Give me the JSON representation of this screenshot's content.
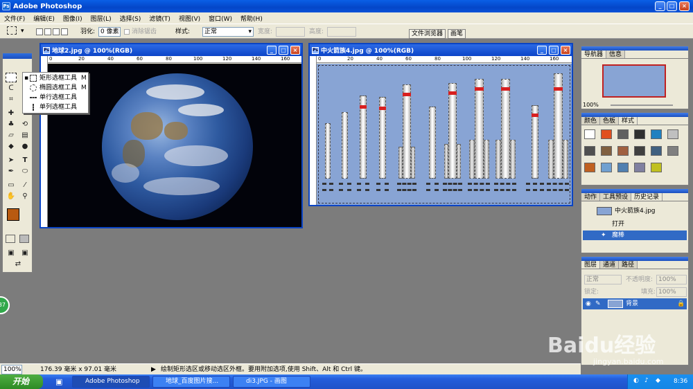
{
  "window": {
    "title": "Adobe Photoshop"
  },
  "menu": [
    "文件(F)",
    "编辑(E)",
    "图像(I)",
    "图层(L)",
    "选择(S)",
    "滤镜(T)",
    "视图(V)",
    "窗口(W)",
    "帮助(H)"
  ],
  "options": {
    "feather_label": "羽化:",
    "feather_value": "0 像素",
    "antialias_label": "消除锯齿",
    "style_label": "样式:",
    "style_value": "正常",
    "width_label": "宽度:",
    "height_label": "高度:",
    "tab_browser": "文件浏览器",
    "tab_brush": "画笔"
  },
  "doc1": {
    "title": "地球2.jpg @ 100%(RGB)",
    "ruler": [
      "0",
      "20",
      "40",
      "60",
      "80",
      "100",
      "120",
      "140",
      "160"
    ]
  },
  "doc2": {
    "title": "中火箭族4.jpg @ 100%(RGB)",
    "ruler": [
      "0",
      "20",
      "40",
      "60",
      "80",
      "100",
      "120",
      "140",
      "160"
    ]
  },
  "tool_menu": [
    {
      "label": "矩形选框工具",
      "shortcut": "M"
    },
    {
      "label": "椭圆选框工具",
      "shortcut": "M"
    },
    {
      "label": "单行选框工具",
      "shortcut": ""
    },
    {
      "label": "单列选框工具",
      "shortcut": ""
    }
  ],
  "navigator": {
    "tabs": [
      "导航器",
      "信息"
    ],
    "zoom": "100%"
  },
  "color_panel": {
    "tabs": [
      "颜色",
      "色板",
      "样式"
    ],
    "swatches": [
      "#ffffff",
      "#e05020",
      "#606060",
      "#303030",
      "#2080c0",
      "#c0c0c0",
      "#505050",
      "#806040",
      "#a06040",
      "#404040",
      "#406080",
      "#808080",
      "#c06020",
      "#70a0d0",
      "#5080b0",
      "#8080a0",
      "#c0c020"
    ]
  },
  "history": {
    "tabs": [
      "动作",
      "工具预设",
      "历史记录"
    ],
    "snapshot": "中火箭族4.jpg",
    "items": [
      "打开",
      "魔棒"
    ]
  },
  "layers": {
    "tabs": [
      "图层",
      "通道",
      "路径"
    ],
    "blend": "正常",
    "opacity_label": "不透明度:",
    "opacity": "100%",
    "lock_label": "锁定:",
    "fill_label": "填充:",
    "fill": "100%",
    "layer_name": "背景"
  },
  "status": {
    "zoom": "100%",
    "size": "176.39 毫米 x 97.01 毫米",
    "hint": "绘制矩形选区或移动选区外框。要用附加选项,使用 Shift、Alt 和 Ctrl 键。"
  },
  "taskbar": {
    "start": "开始",
    "tasks": [
      "Adobe Photoshop",
      "地球_百度图片搜...",
      "di3.JPG - 画图"
    ],
    "clock": "8:36"
  },
  "watermark": {
    "text": "Baidu经验",
    "url": "jingyan.baidu.com"
  },
  "side_badge": "37"
}
